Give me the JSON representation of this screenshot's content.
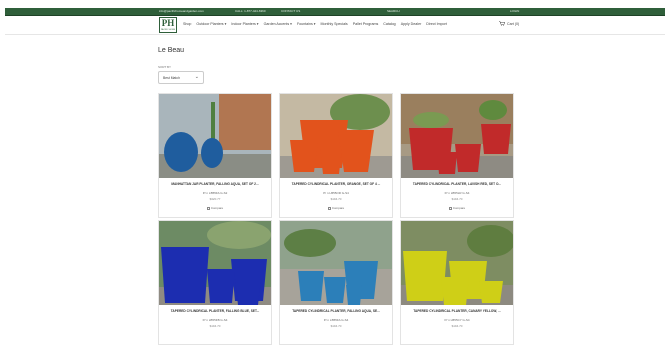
{
  "topbar": {
    "email": "info@pacifichomeandgarden.com",
    "phone": "CALL: 1-877-424-6360",
    "contact": "CONTACT US",
    "search": "SEARCH",
    "login": "LOGIN"
  },
  "logo": {
    "text": "PH",
    "sub": "PACIFIC HOME"
  },
  "menu": [
    "Shop",
    "Outdoor Planters ▾",
    "Indoor Planters ▾",
    "Garden Accents ▾",
    "Fountains ▾",
    "Monthly Specials",
    "Pallet Programs",
    "Catalog",
    "Apply Dealer",
    "Direct Import"
  ],
  "cart": {
    "label": "Cart (0)"
  },
  "page": {
    "title": "Le Beau",
    "sort_label": "SORT BY",
    "sort_value": "Best Match"
  },
  "products": [
    {
      "title": "MANHATTAN JAR PLANTER, FALLING AQUA, SET OF 2...",
      "sku": "P/ n LB55FA G-S2",
      "price": "$320.77",
      "compare": "Compare",
      "bg": "#a9b5bb",
      "pot": "#1f5d9e"
    },
    {
      "title": "TAPERED CYLINDRICAL PLANTER, ORANGE, SET OF 4 ...",
      "sku": "P/ n LB55OR G-S4",
      "price": "$194.70",
      "compare": "Compare",
      "bg": "#c4b9a3",
      "pot": "#e2531c"
    },
    {
      "title": "TAPERED CYLINDRICAL PLANTER, LAVISH RED, SET O...",
      "sku": "P/ n LB55LR G-S4",
      "price": "$194.70",
      "compare": "Compare",
      "bg": "#a79a84",
      "pot": "#c12a2a"
    },
    {
      "title": "TAPERED CYLINDRICAL PLANTER, FALLING BLUE, SET...",
      "sku": "P/ n LB55FB G-S4",
      "price": "$194.70",
      "compare": "",
      "bg": "#6d8b64",
      "pot": "#1c2db0"
    },
    {
      "title": "TAPERED CYLINDRICAL PLANTER, FALLING AQUA, SE...",
      "sku": "P/ n LB55FA G-S4",
      "price": "$194.70",
      "compare": "",
      "bg": "#8fa28c",
      "pot": "#2c7fb9"
    },
    {
      "title": "TAPERED CYLINDRICAL PLANTER, CANARY YELLOW, ...",
      "sku": "P/ n LB55CY G-S4",
      "price": "$194.70",
      "compare": "",
      "bg": "#7e8d62",
      "pot": "#cfcf17"
    }
  ]
}
